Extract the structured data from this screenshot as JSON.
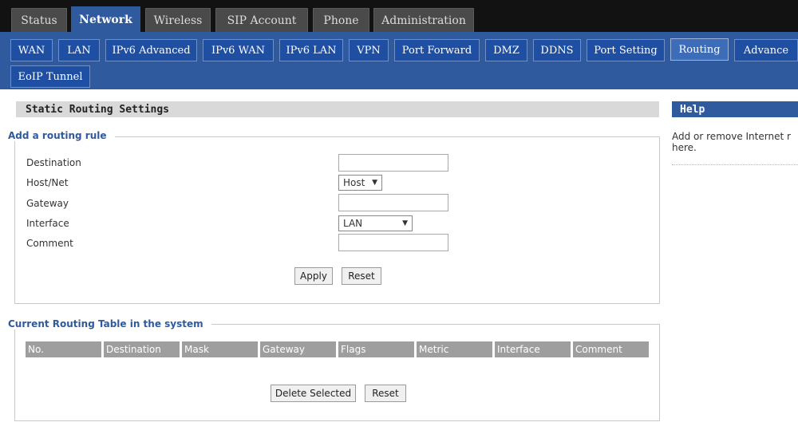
{
  "top_tabs": [
    "Status",
    "Network",
    "Wireless",
    "SIP Account",
    "Phone",
    "Administration"
  ],
  "sub_tabs": [
    "WAN",
    "LAN",
    "IPv6 Advanced",
    "IPv6 WAN",
    "IPv6 LAN",
    "VPN",
    "Port Forward",
    "DMZ",
    "DDNS",
    "Port Setting",
    "Routing",
    "Advance",
    "EoIP Tunnel"
  ],
  "section_title": "Static Routing Settings",
  "add_rule": {
    "legend": "Add a routing rule",
    "labels": {
      "destination": "Destination",
      "host_net": "Host/Net",
      "gateway": "Gateway",
      "interface": "Interface",
      "comment": "Comment"
    },
    "host_net_value": "Host",
    "interface_value": "LAN",
    "apply_label": "Apply",
    "reset_label": "Reset"
  },
  "routing_table": {
    "legend": "Current Routing Table in the system",
    "columns": [
      "No.",
      "Destination",
      "Mask",
      "Gateway",
      "Flags",
      "Metric",
      "Interface",
      "Comment"
    ],
    "delete_label": "Delete Selected",
    "reset_label": "Reset"
  },
  "help": {
    "title": "Help",
    "text_line1": "Add or remove Internet r",
    "text_line2": "here."
  },
  "colors": {
    "nav_blue": "#2f5a9e",
    "tab_blue": "#1e4fa3",
    "top_bar": "#121212",
    "table_header": "#9e9e9e"
  }
}
